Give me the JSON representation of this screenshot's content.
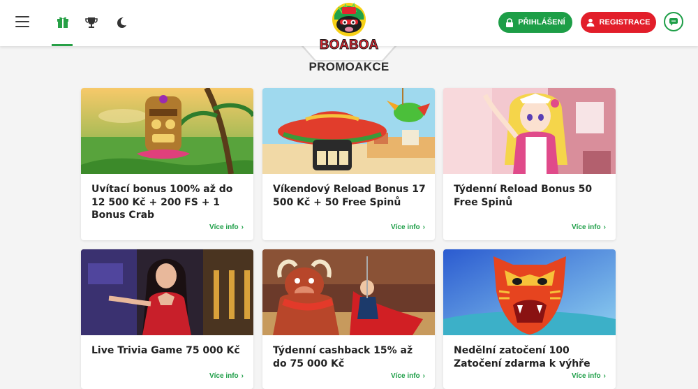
{
  "header": {
    "logo_text": "BOABOA",
    "nav_icons": [
      "menu-icon",
      "gift-icon",
      "trophy-icon",
      "moon-icon"
    ],
    "login_label": "PŘIHLÁŠENÍ",
    "register_label": "REGISTRACE"
  },
  "colors": {
    "brand_green": "#1d9e47",
    "brand_red": "#e21e2a"
  },
  "page_title": "PROMOAKCE",
  "promos": [
    {
      "title": "Uvítací bonus 100% až do 12 500 Kč + 200 FS + 1 Bonus Crab",
      "link": "Více info",
      "image": "tiki-mask"
    },
    {
      "title": "Víkendový Reload Bonus 17 500 Kč + 50 Free Spinů",
      "link": "Více info",
      "image": "sombrero-slot"
    },
    {
      "title": "Týdenní Reload Bonus 50 Free Spinů",
      "link": "Více info",
      "image": "anime-maid"
    },
    {
      "title": "Live Trivia Game 75 000 Kč",
      "link": "Více info",
      "image": "live-dealer"
    },
    {
      "title": "Týdenní cashback 15% až do 75 000 Kč",
      "link": "Více info",
      "image": "bull-matador"
    },
    {
      "title": "Nedělní zatočení 100 Zatočení zdarma k výhře",
      "link": "Více info",
      "image": "tiger-mask"
    }
  ]
}
